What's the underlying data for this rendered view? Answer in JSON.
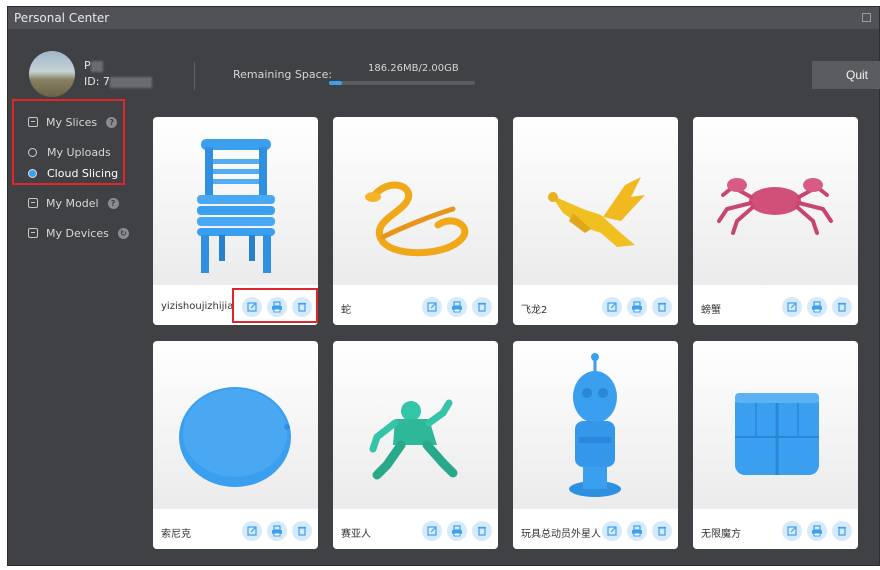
{
  "window": {
    "title": "Personal Center"
  },
  "user": {
    "name_prefix": "P",
    "id_prefix": "ID: 7"
  },
  "storage": {
    "label": "Remaining Space:",
    "value": "186.26MB/2.00GB",
    "used_fraction": 0.09
  },
  "quit_label": "Quit",
  "sidebar": {
    "my_slices": "My Slices",
    "my_uploads": "My Uploads",
    "cloud_slicing": "Cloud Slicing",
    "my_model": "My Model",
    "my_devices": "My Devices"
  },
  "colors": {
    "accent": "#3aa1f0",
    "window_bg": "#404145",
    "highlight_box": "#e0252b",
    "model_blue": "#3b9ff0"
  },
  "cards": [
    {
      "name": "yizishoujizhijia",
      "model": "chair-model"
    },
    {
      "name": "蛇",
      "model": "snake-model"
    },
    {
      "name": "飞龙2",
      "model": "dragon-model"
    },
    {
      "name": "螃蟹",
      "model": "crab-model"
    },
    {
      "name": "索尼克",
      "model": "disc-model"
    },
    {
      "name": "赛亚人",
      "model": "figure-model"
    },
    {
      "name": "玩具总动员外星人",
      "model": "alien-toy-model"
    },
    {
      "name": "无限魔方",
      "model": "cube-model"
    }
  ],
  "card_action_icons": [
    "edit-icon",
    "print-icon",
    "delete-icon"
  ]
}
